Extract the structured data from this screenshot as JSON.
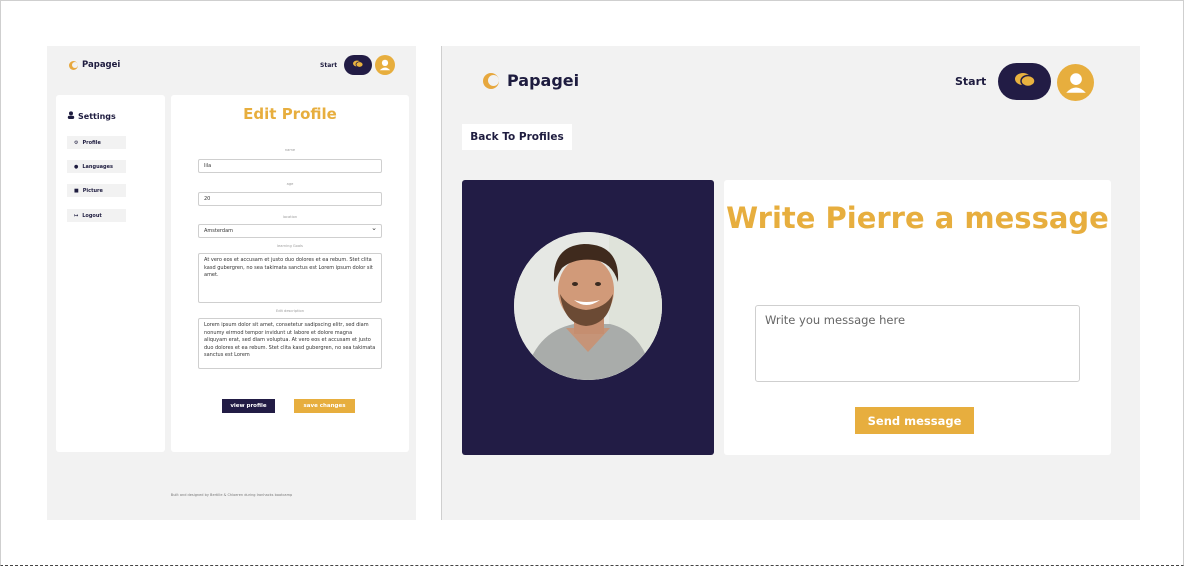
{
  "left_panel": {
    "brand": "Papagei",
    "nav": {
      "start_label": "Start",
      "chat_icon": "chat-bubbles-icon",
      "avatar_icon": "user-avatar-icon"
    },
    "sidebar": {
      "title": "Settings",
      "items": [
        {
          "label": "Profile",
          "icon": "gear-icon"
        },
        {
          "label": "Languages",
          "icon": "chat-bubbles-icon"
        },
        {
          "label": "Picture",
          "icon": "camera-icon"
        },
        {
          "label": "Logout",
          "icon": "logout-icon"
        }
      ]
    },
    "form": {
      "title": "Edit Profile",
      "name_label": "name",
      "name_value": "lila",
      "age_label": "age",
      "age_value": "20",
      "location_label": "location",
      "location_value": "Amsterdam",
      "learning_goals_label": "learning Goals",
      "learning_goals_value": "At vero eos et accusam et justo duo dolores et ea rebum. Stet clita kasd gubergren, no sea takimata sanctus est Lorem ipsum dolor sit amet.",
      "edit_description_label": "Edit description",
      "edit_description_value": "Lorem ipsum dolor sit amet, consetetur sadipscing elitr, sed diam nonumy eirmod tempor invidunt ut labore et dolore magna aliquyam erat, sed diam voluptua. At vero eos et accusam et justo duo dolores et ea rebum. Stet clita kasd gubergren, no sea takimata sanctus est Lorem",
      "view_profile_label": "view profile",
      "save_changes_label": "save changes"
    },
    "footer": "Built and designed by Bertille & Chloeren during Ironhacks bootcamp"
  },
  "right_panel": {
    "brand": "Papagei",
    "nav": {
      "start_label": "Start",
      "chat_icon": "chat-bubbles-icon",
      "avatar_icon": "user-avatar-icon"
    },
    "back_label": "Back To Profiles",
    "message": {
      "title": "Write Pierre a message",
      "placeholder": "Write you message here",
      "send_label": "Send message"
    }
  },
  "colors": {
    "accent": "#e7ae3e",
    "navy": "#221c45",
    "panel_bg": "#f2f2f2"
  }
}
